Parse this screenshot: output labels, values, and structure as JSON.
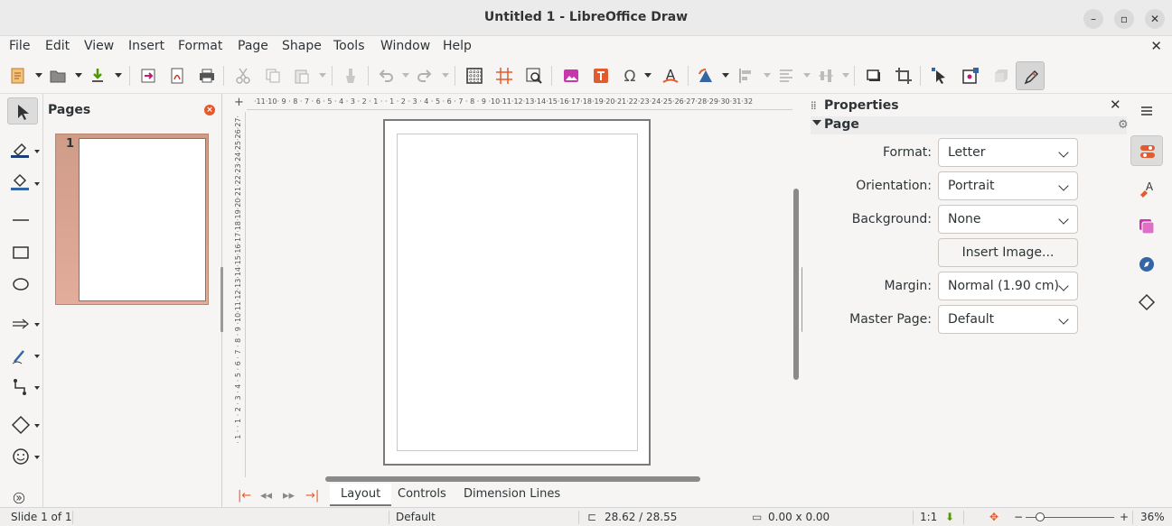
{
  "window": {
    "title": "Untitled 1 - LibreOffice Draw",
    "minimize": "–",
    "maximize": "▫",
    "close": "✕"
  },
  "menu": [
    "File",
    "Edit",
    "View",
    "Insert",
    "Format",
    "Page",
    "Shape",
    "Tools",
    "Window",
    "Help"
  ],
  "menu_close": "✕",
  "pages_pane": {
    "title": "Pages",
    "close": "×",
    "thumbnail_number": "1"
  },
  "ruler": {
    "h_ticks": "·11·10· 9 · 8 · 7 · 6 · 5 · 4 · 3 · 2 · 1 ·  · 1 · 2 · 3 · 4 · 5 · 6 · 7 · 8 · 9 ·10·11·12·13·14·15·16·17·18·19·20·21·22·23·24·25·26·27·28·29·30·31·32",
    "v_ticks": "· 1 · · 1 · 2 · 3 · 4 · 5 · 6 · 7 · 8 · 9 ·10·11·12·13·14·15·16·17·18·19·20·21·22·23·24·25·26·27·",
    "corner": "+"
  },
  "tabs": {
    "layout": "Layout",
    "controls": "Controls",
    "dimension_lines": "Dimension Lines"
  },
  "nav": {
    "first": "|←",
    "prev": "◂◂",
    "next": "▸▸",
    "last": "→|"
  },
  "properties": {
    "title": "Properties",
    "close": "✕",
    "section": "Page",
    "gear": "⚙",
    "format": {
      "label": "Format:",
      "value": "Letter"
    },
    "orientation": {
      "label": "Orientation:",
      "value": "Portrait"
    },
    "background": {
      "label": "Background:",
      "value": "None"
    },
    "insert_image": "Insert Image...",
    "margin": {
      "label": "Margin:",
      "value": "Normal (1.90 cm)"
    },
    "master_page": {
      "label": "Master Page:",
      "value": "Default"
    }
  },
  "status": {
    "slide": "Slide 1 of 1",
    "master": "Default",
    "position": "28.62 / 28.55",
    "size": "0.00 x 0.00",
    "scale": "1:1",
    "zoom_minus": "−",
    "zoom_plus": "+",
    "zoom": "36%"
  },
  "colors": {
    "accent": "#e35b2c",
    "fill_color": "#3465a4",
    "selection": "#d6d6d6"
  }
}
